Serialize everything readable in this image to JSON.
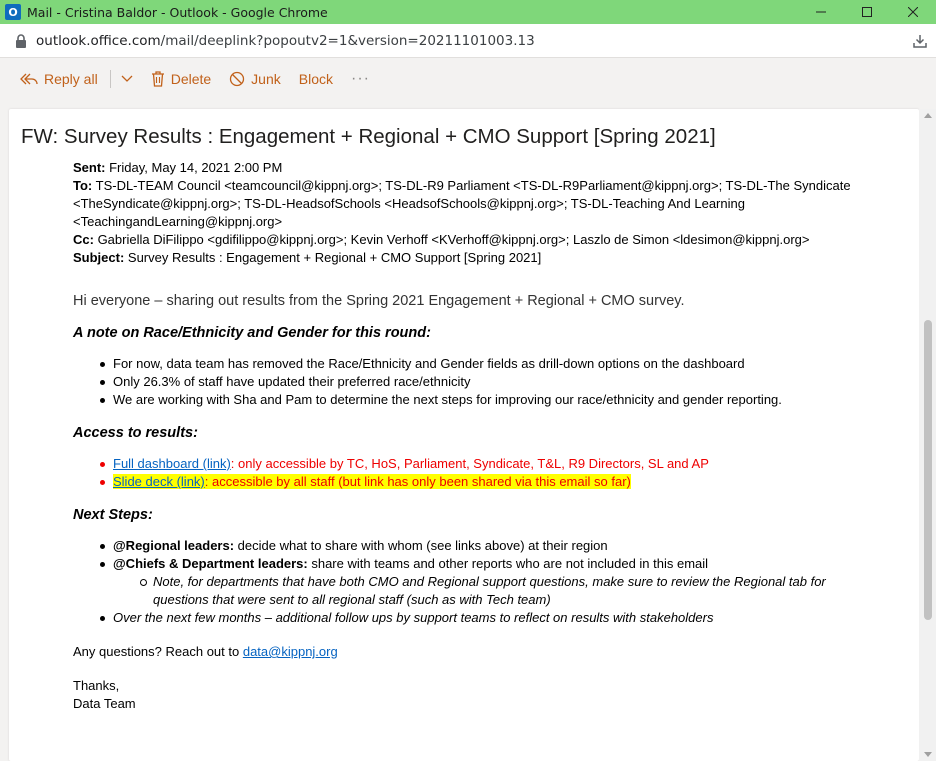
{
  "window": {
    "title": "Mail - Cristina Baldor - Outlook - Google Chrome",
    "app_icon_letter": "O"
  },
  "address": {
    "host": "outlook.office.com",
    "path": "/mail/deeplink?popoutv2=1&version=20211101003.13"
  },
  "toolbar": {
    "reply_all": "Reply all",
    "delete": "Delete",
    "junk": "Junk",
    "block": "Block",
    "more": "···"
  },
  "email": {
    "subject": "FW: Survey Results : Engagement + Regional + CMO Support [Spring 2021]",
    "headers": {
      "sent_label": "Sent:",
      "sent": " Friday, May 14, 2021 2:00 PM",
      "to_label": "To:",
      "to": " TS-DL-TEAM Council <teamcouncil@kippnj.org>; TS-DL-R9 Parliament <TS-DL-R9Parliament@kippnj.org>; TS-DL-The Syndicate <TheSyndicate@kippnj.org>; TS-DL-HeadsofSchools <HeadsofSchools@kippnj.org>; TS-DL-Teaching And Learning <TeachingandLearning@kippnj.org>",
      "cc_label": "Cc:",
      "cc": " Gabriella DiFilippo <gdifilippo@kippnj.org>; Kevin Verhoff <KVerhoff@kippnj.org>; Laszlo de Simon <ldesimon@kippnj.org>",
      "subject_label": "Subject:",
      "subject": " Survey Results : Engagement + Regional + CMO Support [Spring 2021]"
    },
    "greeting": "Hi everyone – sharing out results from the Spring 2021 Engagement + Regional + CMO survey.",
    "note_heading": "A note on Race/Ethnicity and Gender for this round:",
    "note_items": [
      "For now, data team has removed the Race/Ethnicity and Gender fields as drill-down options on the dashboard",
      "Only 26.3% of staff have updated their preferred race/ethnicity",
      "We are working with Sha and Pam to determine the next steps for improving our race/ethnicity and gender reporting."
    ],
    "access_heading": "Access to results:",
    "access_items": [
      {
        "link": "Full dashboard (link)",
        "text": ": only accessible by TC, HoS, Parliament, Syndicate, T&L, R9 Directors, SL and AP"
      },
      {
        "link": "Slide deck (link)",
        "text": ": accessible by all staff (but link has only been shared via this email so far)"
      }
    ],
    "next_heading": "Next Steps:",
    "next_items": [
      {
        "bold": "@Regional leaders:",
        "text": " decide what to share with whom (see links above) at their region"
      },
      {
        "bold": "@Chiefs & Department leaders:",
        "text": " share with teams and other reports who are not included in this email"
      }
    ],
    "next_sub_item": "Note, for departments that have both CMO and Regional support questions, make sure to review the Regional tab for questions that were sent to all regional staff (such as with Tech team)",
    "next_last_item": "Over the next few months – additional follow ups by support teams to reflect on results with stakeholders",
    "questions_text": "Any questions?  Reach out to ",
    "questions_email": "data@kippnj.org",
    "thanks": "Thanks,",
    "signature": "Data Team"
  },
  "colors": {
    "titlebar": "#7fd77a",
    "toolbar_accent": "#c1611a",
    "link": "#0563c1",
    "red_text": "#ee0000",
    "highlight": "#ffff00"
  }
}
